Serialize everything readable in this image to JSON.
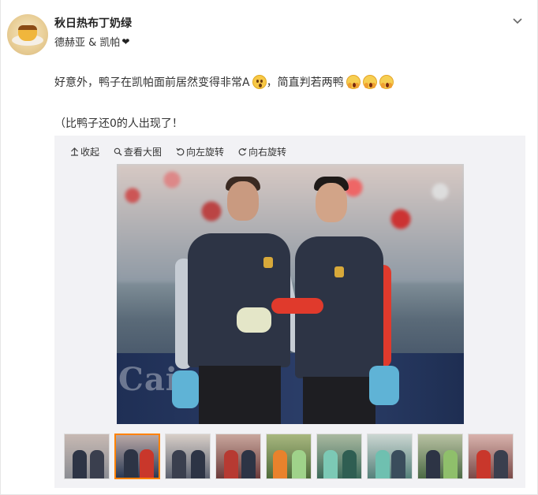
{
  "post": {
    "author": "秋日热布丁奶绿",
    "source_prefix": "德赫亚 & 凯帕",
    "source_suffix": "❤",
    "text_line1": "好意外，鸭子在凯帕面前居然变得非常A",
    "text_line1_after_emoji": "，简直判若两鸭",
    "text_line2": "（比鸭子还0的人出现了！"
  },
  "toolbar": {
    "collapse": "收起",
    "view_large": "查看大图",
    "rotate_left": "向左旋转",
    "rotate_right": "向右旋转"
  },
  "main_image": {
    "board_text": "Caixa"
  },
  "thumbnails": {
    "count": 9,
    "active_index": 1
  },
  "colors": {
    "accent": "#ff8200",
    "text": "#333333",
    "panel_bg": "#f2f2f5"
  },
  "icons": {
    "dropdown": "chevron-down-icon",
    "collapse": "arrow-up-icon",
    "view_large": "magnifier-icon",
    "rotate_left": "rotate-left-icon",
    "rotate_right": "rotate-right-icon"
  }
}
